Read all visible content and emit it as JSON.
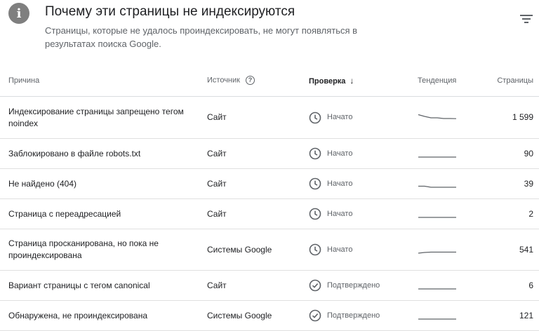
{
  "header": {
    "icon": "info-icon",
    "title": "Почему эти страницы не индексируются",
    "subtitle": "Страницы, которые не удалось проиндексировать, не могут появляться в результатах поиска Google.",
    "filter_icon": "filter-icon"
  },
  "columns": {
    "reason": "Причина",
    "source": "Источник",
    "check": "Проверка",
    "trend": "Тенденция",
    "pages": "Страницы"
  },
  "rows": [
    {
      "reason": "Индексирование страницы запрещено тегом noindex",
      "source": "Сайт",
      "status": "Начато",
      "status_icon": "clock-icon",
      "trend": [
        0.05,
        0.3,
        0.5,
        0.5,
        0.6,
        0.6,
        0.62
      ],
      "pages": "1 599"
    },
    {
      "reason": "Заблокировано в файле robots.txt",
      "source": "Сайт",
      "status": "Начато",
      "status_icon": "clock-icon",
      "trend": [
        1,
        1,
        1,
        1,
        1,
        1,
        1
      ],
      "pages": "90"
    },
    {
      "reason": "Не найдено (404)",
      "source": "Сайт",
      "status": "Начато",
      "status_icon": "clock-icon",
      "trend": [
        0.85,
        0.85,
        1,
        1,
        1,
        1,
        1
      ],
      "pages": "39"
    },
    {
      "reason": "Страница с переадресацией",
      "source": "Сайт",
      "status": "Начато",
      "status_icon": "clock-icon",
      "trend": [
        1,
        1,
        1,
        1,
        1,
        1,
        1
      ],
      "pages": "2"
    },
    {
      "reason": "Страница просканирована, но пока не проиндексирована",
      "source": "Системы Google",
      "status": "Начато",
      "status_icon": "clock-icon",
      "trend": [
        1,
        0.9,
        0.85,
        0.85,
        0.85,
        0.85,
        0.85
      ],
      "pages": "541"
    },
    {
      "reason": "Вариант страницы с тегом canonical",
      "source": "Сайт",
      "status": "Подтверждено",
      "status_icon": "check-circle-icon",
      "trend": [
        1,
        1,
        1,
        1,
        1,
        1,
        1
      ],
      "pages": "6"
    },
    {
      "reason": "Обнаружена, не проиндексирована",
      "source": "Системы Google",
      "status": "Подтверждено",
      "status_icon": "check-circle-icon",
      "trend": [
        1,
        1,
        1,
        1,
        1,
        1,
        1
      ],
      "pages": "121"
    }
  ]
}
